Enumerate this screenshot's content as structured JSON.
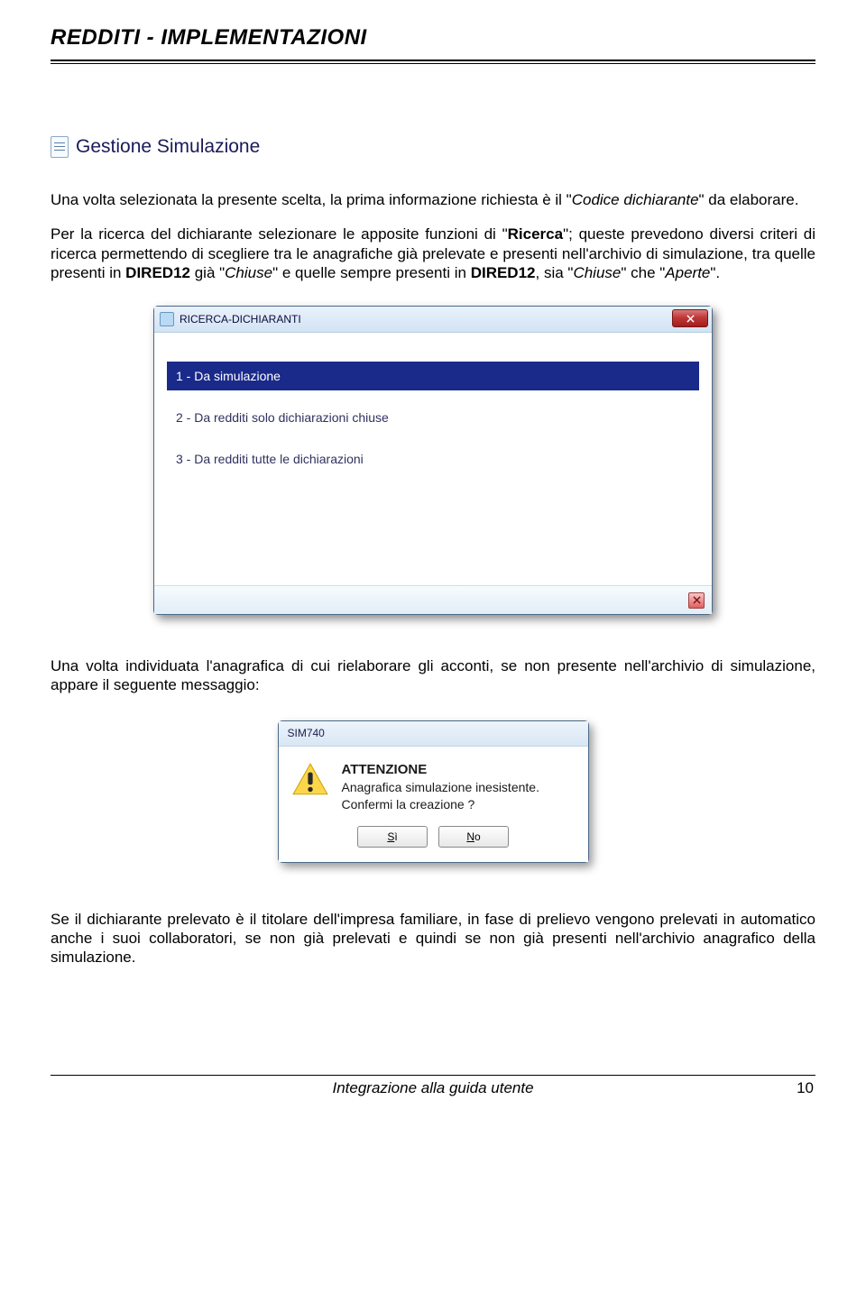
{
  "header": {
    "title": "REDDITI - IMPLEMENTAZIONI"
  },
  "gestione": {
    "label": "Gestione Simulazione"
  },
  "para1": {
    "pre": "Una volta selezionata la presente scelta, la prima informazione richiesta è il \"",
    "italic": "Codice dichiarante",
    "post": "\" da elaborare."
  },
  "para2": {
    "pre": "Per la ricerca del dichiarante selezionare le apposite funzioni di \"",
    "bold1": "Ricerca",
    "mid1": "\"; queste prevedono diversi criteri di ricerca permettendo di scegliere tra le anagrafiche già prelevate e presenti nell'archivio di simulazione, tra quelle presenti in ",
    "bold2": "DIRED12",
    "mid2": " già \"",
    "italic1": "Chiuse",
    "mid3": "\" e quelle sempre presenti in ",
    "bold3": "DIRED12",
    "mid4": ", sia \"",
    "italic2": "Chiuse",
    "mid5": "\" che \"",
    "italic3": "Aperte",
    "post": "\"."
  },
  "window1": {
    "title": "RICERCA-DICHIARANTI",
    "items": [
      "1 - Da simulazione",
      "2 - Da redditi solo dichiarazioni chiuse",
      "3 - Da redditi tutte le dichiarazioni"
    ]
  },
  "para3": "Una volta individuata l'anagrafica di cui rielaborare gli acconti, se non presente nell'archivio di simulazione, appare il seguente messaggio:",
  "dialog": {
    "title": "SIM740",
    "heading": "ATTENZIONE",
    "line1": "Anagrafica simulazione inesistente.",
    "line2": "Confermi la creazione ?",
    "btn_yes_u": "S",
    "btn_yes_r": "ì",
    "btn_no_u": "N",
    "btn_no_r": "o"
  },
  "para4": "Se il dichiarante prelevato è il titolare dell'impresa familiare, in fase di prelievo vengono prelevati in automatico anche i suoi collaboratori, se non già prelevati e quindi se non già presenti nell'archivio anagrafico della simulazione.",
  "footer": {
    "label": "Integrazione alla guida utente",
    "page": "10"
  }
}
